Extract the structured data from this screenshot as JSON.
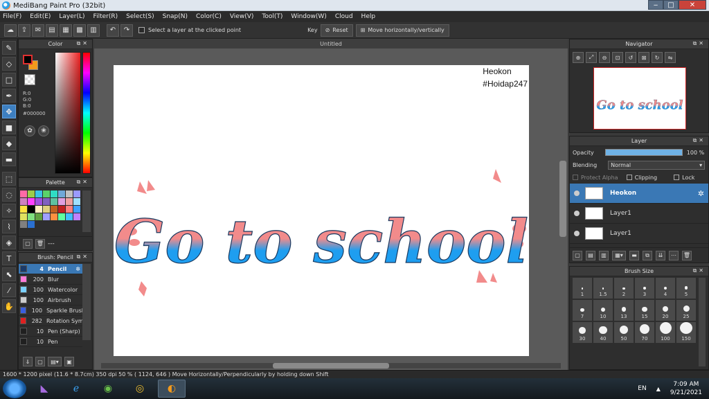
{
  "window": {
    "title": "MediBang Paint Pro (32bit)"
  },
  "menu": [
    "File(F)",
    "Edit(E)",
    "Layer(L)",
    "Filter(R)",
    "Select(S)",
    "Snap(N)",
    "Color(C)",
    "View(V)",
    "Tool(T)",
    "Window(W)",
    "Cloud",
    "Help"
  ],
  "toolbar": {
    "select_layer_label": "Select a layer at the clicked point",
    "key_label": "Key",
    "reset_label": "Reset",
    "move_label": "Move horizontally/vertically"
  },
  "color_panel": {
    "title": "Color",
    "r": "R:0",
    "g": "G:0",
    "b": "B:0",
    "hex": "#000000"
  },
  "palette_panel": {
    "title": "Palette",
    "colors": [
      "#ff6aa6",
      "#9ccc4a",
      "#3bc4e6",
      "#5ad36a",
      "#2fdcc4",
      "#70a8d8",
      "#c0c0c0",
      "#9a9aff",
      "#d080c0",
      "#ff40ff",
      "#a050e0",
      "#8060c0",
      "#60c0a0",
      "#e0a0e0",
      "#f0a0a0",
      "#a0e0ff",
      "#ffe040",
      "#000000",
      "#fff0c0",
      "#e0d080",
      "#c06020",
      "#c02020",
      "#ff8080",
      "#40a0ff",
      "#e0e060",
      "#80e080",
      "#60a040",
      "#a0a0ff",
      "#ff9040",
      "#60ffa0",
      "#40c0ff",
      "#c080ff",
      "#808080",
      "#2a70d0"
    ],
    "count_label": "---"
  },
  "brush_panel": {
    "title": "Brush: Pencil",
    "brushes": [
      {
        "size": "4",
        "name": "Pencil",
        "color": "#1a3a6a"
      },
      {
        "size": "200",
        "name": "Blur",
        "color": "#ff7ad9"
      },
      {
        "size": "100",
        "name": "Watercolor",
        "color": "#7ad0ff"
      },
      {
        "size": "100",
        "name": "Airbrush",
        "color": "#cccccc"
      },
      {
        "size": "100",
        "name": "Sparkle Brush",
        "color": "#3a5fe0"
      },
      {
        "size": "282",
        "name": "Rotation Symmetry",
        "color": "#e02020"
      },
      {
        "size": "10",
        "name": "Pen (Sharp)",
        "color": "#202020"
      },
      {
        "size": "10",
        "name": "Pen",
        "color": "#202020"
      }
    ]
  },
  "canvas": {
    "tab_title": "Untitled",
    "watermark_line1": "Heokon",
    "watermark_line2": "#Hoidap247",
    "text_art": "Go to school",
    "art_gradient_top": "#f28b8b",
    "art_gradient_bottom": "#1e9ef0"
  },
  "navigator_panel": {
    "title": "Navigator"
  },
  "layer_panel": {
    "title": "Layer",
    "opacity_label": "Opacity",
    "opacity_value": "100 %",
    "opacity": 1.0,
    "blending_label": "Blending",
    "blending_value": "Normal",
    "protect_alpha": "Protect Alpha",
    "clipping": "Clipping",
    "lock": "Lock",
    "layers": [
      {
        "name": "Heokon",
        "selected": true
      },
      {
        "name": "Layer1",
        "selected": false
      },
      {
        "name": "Layer1",
        "selected": false
      }
    ]
  },
  "brush_size_panel": {
    "title": "Brush Size",
    "sizes": [
      "1",
      "1.5",
      "2",
      "3",
      "4",
      "5",
      "7",
      "10",
      "13",
      "15",
      "20",
      "25",
      "30",
      "40",
      "50",
      "70",
      "100",
      "150"
    ]
  },
  "status": {
    "text": "1600 * 1200 pixel  (11.6 * 8.7cm)  350 dpi  50 %  ( 1124, 646 )  Move Horizontally/Perpendicularly by holding down Shift"
  },
  "taskbar": {
    "lang": "EN",
    "time": "7:09 AM",
    "date": "9/21/2021"
  }
}
